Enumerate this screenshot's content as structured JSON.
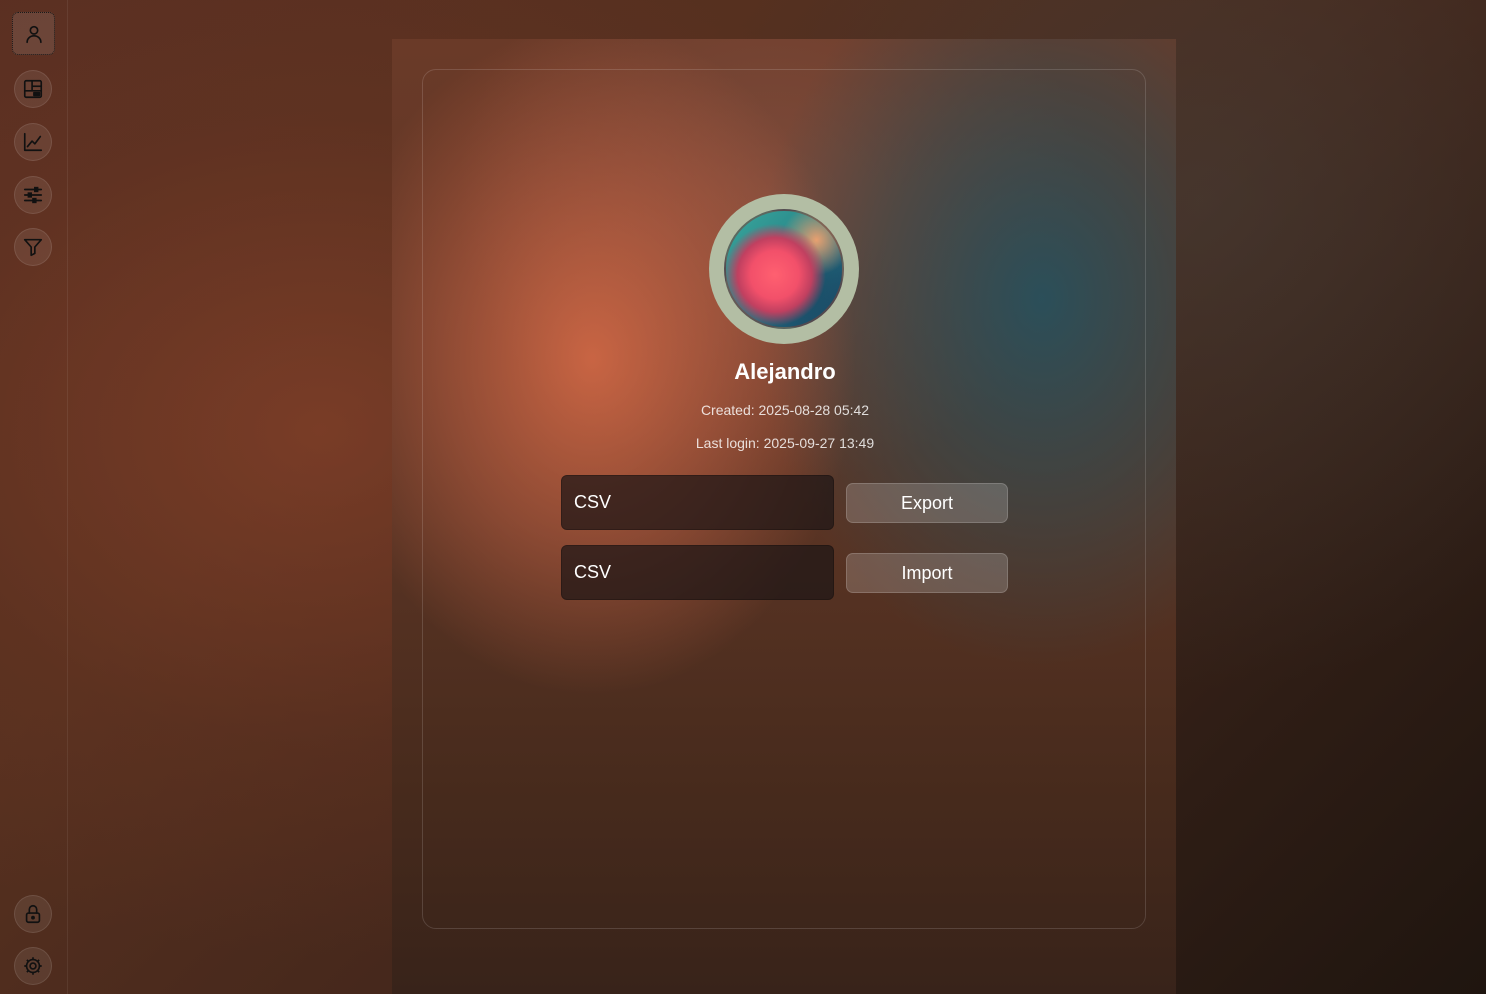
{
  "sidebar": {
    "top_items": [
      {
        "icon": "user-icon",
        "active": true
      },
      {
        "icon": "dashboard-icon",
        "active": false
      },
      {
        "icon": "line-chart-icon",
        "active": false
      },
      {
        "icon": "sliders-icon",
        "active": false
      },
      {
        "icon": "filter-icon",
        "active": false
      }
    ],
    "bottom_items": [
      {
        "icon": "lock-icon"
      },
      {
        "icon": "gear-icon"
      }
    ]
  },
  "profile": {
    "name": "Alejandro",
    "created": "Created: 2025-08-28 05:42",
    "last_login": "Last login: 2025-09-27 13:49"
  },
  "data_transfer": {
    "export_format_value": "CSV",
    "export_label": "Export",
    "import_format_value": "CSV",
    "import_label": "Import"
  },
  "colors": {
    "avatar_ring": "#b3bea4",
    "text": "#ffffff"
  }
}
